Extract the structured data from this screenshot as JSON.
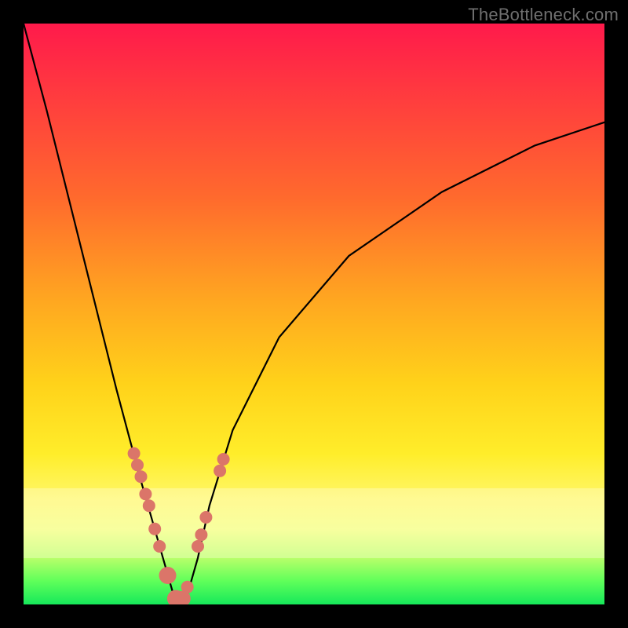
{
  "watermark": "TheBottleneck.com",
  "colors": {
    "gradient_top": "#ff1a4b",
    "gradient_mid_orange": "#ffa820",
    "gradient_yellow": "#ffed2a",
    "gradient_green": "#16e85a",
    "curve": "#000000",
    "marker": "#db7569",
    "frame": "#000000"
  },
  "chart_data": {
    "type": "line",
    "title": "",
    "xlabel": "",
    "ylabel": "",
    "xlim": [
      0,
      100
    ],
    "ylim": [
      0,
      100
    ],
    "grid": false,
    "note": "V-shaped bottleneck curve. Y represents bottleneck % (0 at bottom). Minimum near x≈26.",
    "series": [
      {
        "name": "bottleneck-curve",
        "x": [
          0,
          4,
          8,
          12,
          16,
          20,
          22,
          24,
          26,
          28,
          30,
          32,
          36,
          44,
          56,
          72,
          88,
          100
        ],
        "y": [
          100,
          85,
          69,
          53,
          37,
          22,
          15,
          8,
          1,
          1,
          8,
          17,
          30,
          46,
          60,
          71,
          79,
          83
        ]
      }
    ],
    "markers": {
      "name": "highlighted-points",
      "fill": "#db7569",
      "x": [
        19.0,
        19.6,
        20.2,
        21.0,
        21.6,
        22.6,
        23.4,
        24.8,
        26.2,
        27.4,
        28.2,
        30.0,
        30.6,
        31.4,
        33.8,
        34.4
      ],
      "y": [
        26,
        24,
        22,
        19,
        17,
        13,
        10,
        5,
        1,
        1,
        3,
        10,
        12,
        15,
        23,
        25
      ],
      "r": [
        8,
        8,
        8,
        8,
        8,
        8,
        8,
        11,
        11,
        10,
        8,
        8,
        8,
        8,
        8,
        8
      ]
    },
    "pale_band": {
      "y_from": 8,
      "y_to": 20
    }
  }
}
